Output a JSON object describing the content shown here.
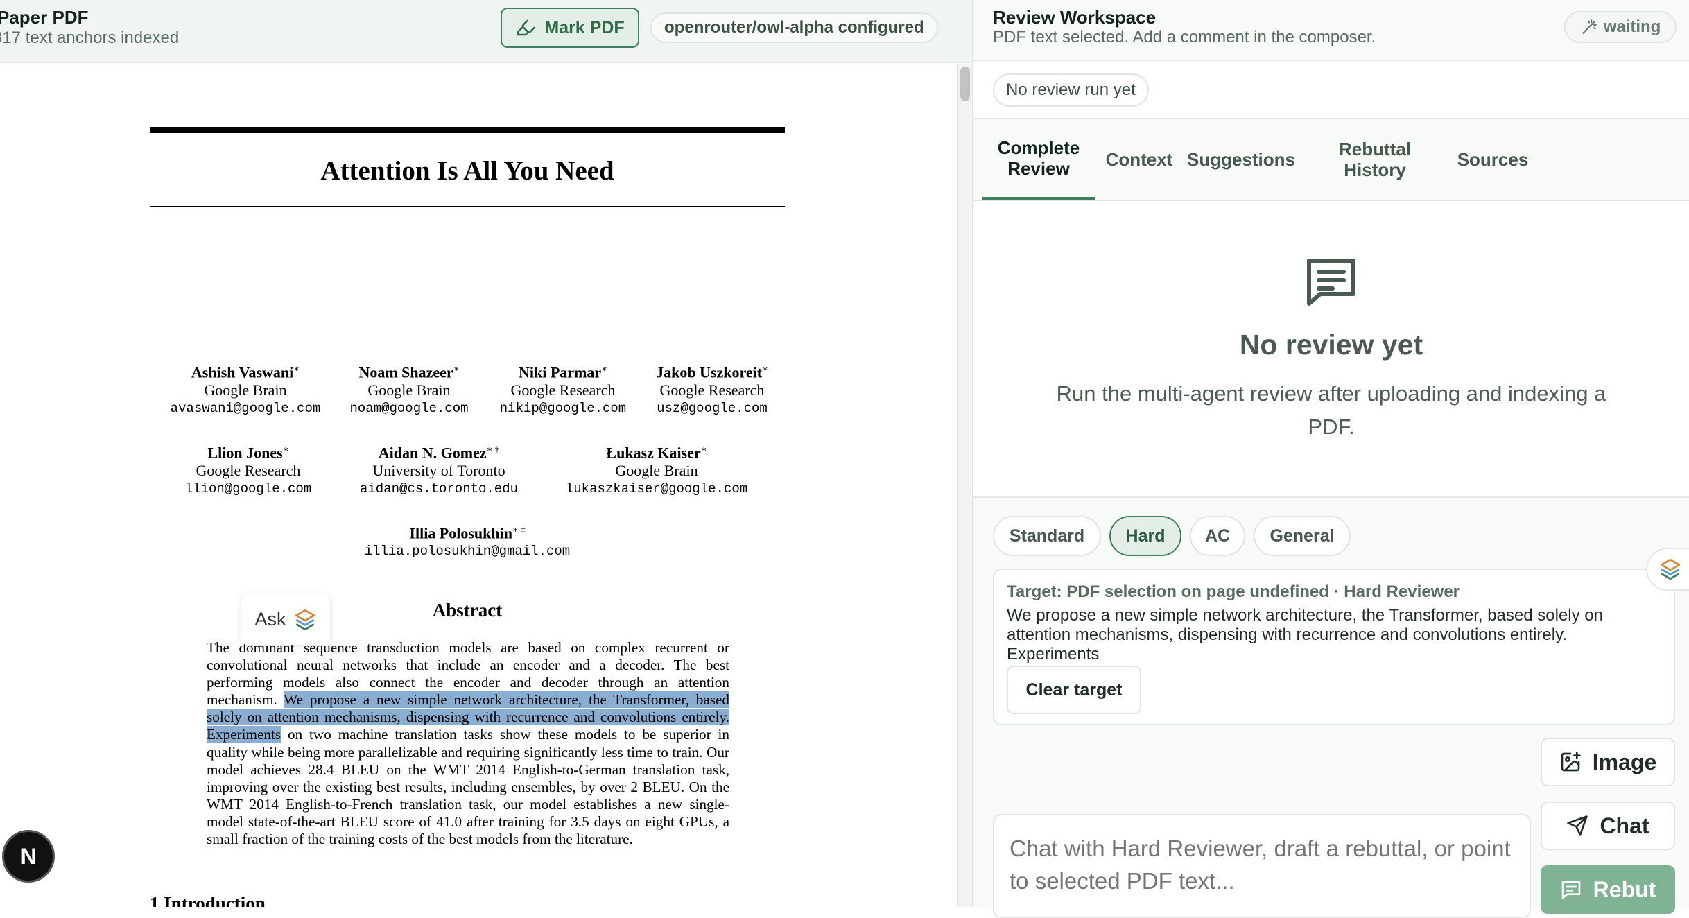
{
  "left_header": {
    "title": "Paper PDF",
    "subtitle": "317 text anchors indexed",
    "mark_button": "Mark PDF",
    "model_status": "openrouter/owl-alpha configured"
  },
  "paper": {
    "title": "Attention Is All You Need",
    "authors": [
      {
        "name": "Ashish Vaswani",
        "mark": "∗",
        "affiliation": "Google Brain",
        "email": "avaswani@google.com"
      },
      {
        "name": "Noam Shazeer",
        "mark": "∗",
        "affiliation": "Google Brain",
        "email": "noam@google.com"
      },
      {
        "name": "Niki Parmar",
        "mark": "∗",
        "affiliation": "Google Research",
        "email": "nikip@google.com"
      },
      {
        "name": "Jakob Uszkoreit",
        "mark": "∗",
        "affiliation": "Google Research",
        "email": "usz@google.com"
      },
      {
        "name": "Llion Jones",
        "mark": "∗",
        "affiliation": "Google Research",
        "email": "llion@google.com"
      },
      {
        "name": "Aidan N. Gomez",
        "mark": "∗ †",
        "affiliation": "University of Toronto",
        "email": "aidan@cs.toronto.edu"
      },
      {
        "name": "Łukasz Kaiser",
        "mark": "∗",
        "affiliation": "Google Brain",
        "email": "lukaszkaiser@google.com"
      },
      {
        "name": "Illia Polosukhin",
        "mark": "∗ ‡",
        "affiliation": "",
        "email": "illia.polosukhin@gmail.com"
      }
    ],
    "abstract_heading": "Abstract",
    "abstract_before": "The dominant sequence transduction models are based on complex recurrent or convolutional neural networks that include an encoder and a decoder. The best performing models also connect the encoder and decoder through an attention mechanism. ",
    "abstract_selected": "We propose a new simple network architecture, the Transformer, based solely on attention mechanisms, dispensing with recurrence and convolutions entirely. Experiments",
    "abstract_after": " on two machine translation tasks show these models to be superior in quality while being more parallelizable and requiring significantly less time to train. Our model achieves 28.4 BLEU on the WMT 2014 English-to-German translation task, improving over the existing best results, including ensembles, by over 2 BLEU. On the WMT 2014 English-to-French translation task, our model establishes a new single-model state-of-the-art BLEU score of 41.0 after training for 3.5 days on eight GPUs, a small fraction of the training costs of the best models from the literature.",
    "intro_heading": "1   Introduction"
  },
  "ask_chip": {
    "label": "Ask"
  },
  "n_badge": {
    "label": "N"
  },
  "right_header": {
    "title": "Review Workspace",
    "subtitle": "PDF text selected. Add a comment in the composer.",
    "status": "waiting"
  },
  "run_status": "No review run yet",
  "tabs": [
    {
      "label": "Complete Review",
      "active": true
    },
    {
      "label": "Context",
      "active": false
    },
    {
      "label": "Suggestions",
      "active": false
    },
    {
      "label": "Rebuttal History",
      "active": false
    },
    {
      "label": "Sources",
      "active": false
    }
  ],
  "empty_state": {
    "icon": "message-square-icon",
    "title": "No review yet",
    "description": "Run the multi-agent review after uploading and indexing a PDF."
  },
  "modes": [
    {
      "label": "Standard",
      "active": false
    },
    {
      "label": "Hard",
      "active": true
    },
    {
      "label": "AC",
      "active": false
    },
    {
      "label": "General",
      "active": false
    }
  ],
  "target": {
    "label": "Target: PDF selection on page undefined · Hard Reviewer",
    "text": "We propose a new simple network architecture, the Transformer, based solely on attention mechanisms, dispensing with recurrence and convolutions entirely. Experiments",
    "clear_button": "Clear target"
  },
  "actions": {
    "image": "Image",
    "chat": "Chat",
    "rebut": "Rebut"
  },
  "chat": {
    "placeholder": "Chat with Hard Reviewer, draft a rebuttal, or point to selected PDF text..."
  },
  "colors": {
    "accent": "#3f7f5f",
    "selection": "#8aaed2",
    "rebut_button": "#7fb394"
  }
}
